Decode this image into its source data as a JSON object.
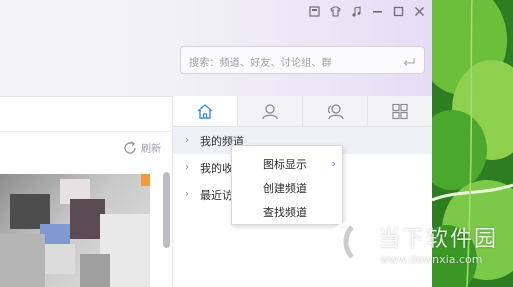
{
  "window": {
    "controls": [
      "skin-icon",
      "shirt-icon",
      "music-icon",
      "minimize-icon",
      "maximize-icon",
      "close-icon"
    ]
  },
  "search": {
    "placeholder": "搜索：频道、好友、讨论组、群"
  },
  "left": {
    "refresh_label": "刷新"
  },
  "tabs": [
    {
      "icon": "home-icon",
      "active": true
    },
    {
      "icon": "person-icon",
      "active": false
    },
    {
      "icon": "group-icon",
      "active": false
    },
    {
      "icon": "grid-icon",
      "active": false
    }
  ],
  "tree": {
    "nodes": [
      {
        "label": "我的频道"
      },
      {
        "label": "我的收"
      },
      {
        "label": "最近访"
      }
    ]
  },
  "context_menu": {
    "items": [
      {
        "label": "图标显示",
        "has_submenu": true
      },
      {
        "label": "创建频道"
      },
      {
        "label": "查找频道"
      }
    ]
  },
  "watermark": {
    "title": "当下软件园",
    "url": "www.downxia.com"
  },
  "colors": {
    "accent": "#4a86d8",
    "orange_tag": "#f29a3c",
    "wallpaper": "#3d8b2a"
  }
}
